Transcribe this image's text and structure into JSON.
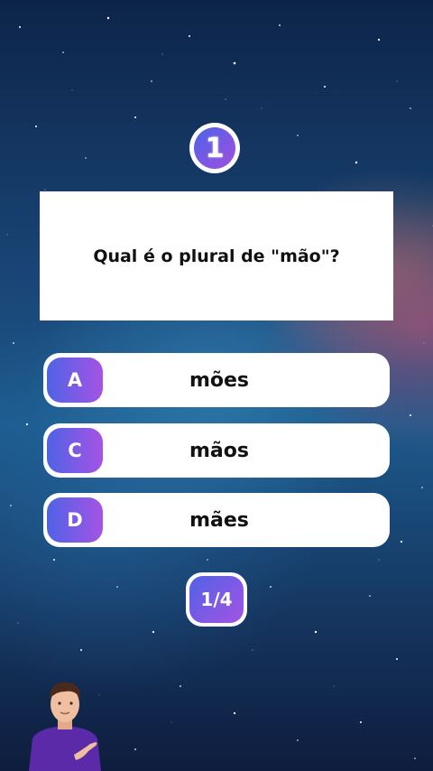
{
  "quiz": {
    "question_number": "1",
    "question": "Qual é o plural de \"mão\"?",
    "options": [
      {
        "letter": "A",
        "answer": "mões"
      },
      {
        "letter": "C",
        "answer": "mãos"
      },
      {
        "letter": "D",
        "answer": "mães"
      }
    ],
    "progress": "1/4"
  },
  "colors": {
    "accent_start": "#4f63e6",
    "accent_end": "#a553e4",
    "card": "#ffffff",
    "text": "#111111"
  },
  "icons": {
    "presenter": "presenter-avatar"
  }
}
